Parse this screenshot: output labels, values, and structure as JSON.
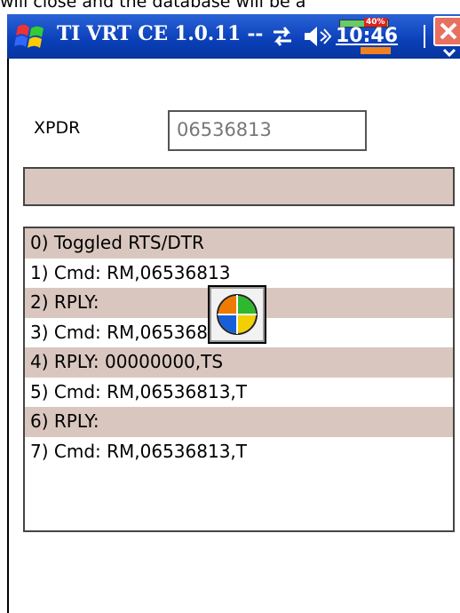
{
  "top_strip": {
    "text": "will close and the database will be a"
  },
  "titlebar": {
    "title": "TI VRT CE 1.0.11 --",
    "clock": "10:46",
    "battery_pct": "40%",
    "start_icon": "windows-flag-icon",
    "connectivity_icon": "connectivity-arrows-icon",
    "volume_icon": "speaker-icon",
    "close_icon": "close-icon"
  },
  "form": {
    "xpdr_label": "XPDR",
    "xpdr_value": "06536813",
    "status_text": ""
  },
  "log": {
    "rows": [
      "0) Toggled RTS/DTR",
      "1) Cmd: RM,06536813",
      "2) RPLY:",
      "3) Cmd: RM,06536813",
      "4) RPLY: 00000000,TS",
      "5) Cmd: RM,06536813,T",
      "6) RPLY:",
      "7) Cmd: RM,06536813,T"
    ]
  },
  "busy_indicator": {
    "icon": "wait-cursor-icon"
  },
  "colors": {
    "titlebar": "#0a3fb8",
    "row_shade": "#d9c7bf",
    "close_button": "#e87060"
  }
}
